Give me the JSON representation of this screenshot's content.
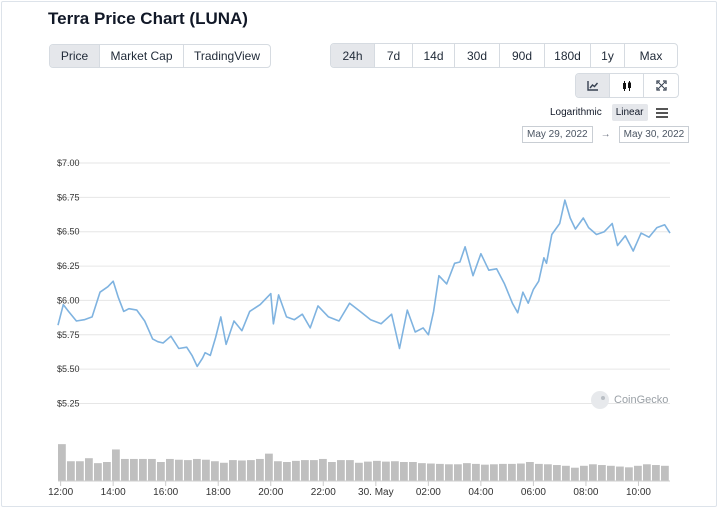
{
  "title": "Terra Price Chart (LUNA)",
  "view_tabs": [
    {
      "label": "Price",
      "active": true
    },
    {
      "label": "Market Cap",
      "active": false
    },
    {
      "label": "TradingView",
      "active": false
    }
  ],
  "range_tabs": [
    {
      "label": "24h",
      "active": true
    },
    {
      "label": "7d",
      "active": false
    },
    {
      "label": "14d",
      "active": false
    },
    {
      "label": "30d",
      "active": false
    },
    {
      "label": "90d",
      "active": false
    },
    {
      "label": "180d",
      "active": false
    },
    {
      "label": "1y",
      "active": false
    },
    {
      "label": "Max",
      "active": false
    }
  ],
  "tools": [
    {
      "icon": "line-chart-icon",
      "active": true
    },
    {
      "icon": "candlestick-icon",
      "active": false
    },
    {
      "icon": "fullscreen-icon",
      "active": false
    }
  ],
  "scale": {
    "logarithmic": "Logarithmic",
    "linear": "Linear",
    "active": "linear"
  },
  "date_range": {
    "from": "May 29, 2022",
    "to": "May 30, 2022",
    "arrow": "→"
  },
  "watermark": "CoinGecko",
  "colors": {
    "line": "#7fb3e0",
    "volume": "#bfbfbf",
    "grid": "#e6e6e6",
    "axis_text": "#333333"
  },
  "chart_data": {
    "type": "line",
    "title": "",
    "xlabel": "",
    "ylabel": "",
    "y_ticks": [
      "$5.25",
      "$5.50",
      "$5.75",
      "$6.00",
      "$6.25",
      "$6.50",
      "$6.75",
      "$7.00"
    ],
    "y_tick_values": [
      5.25,
      5.5,
      5.75,
      6.0,
      6.25,
      6.5,
      6.75,
      7.0
    ],
    "ylim": [
      5.13,
      7.0
    ],
    "x_ticks": [
      "12:00",
      "14:00",
      "16:00",
      "18:00",
      "20:00",
      "22:00",
      "30. May",
      "02:00",
      "04:00",
      "06:00",
      "08:00",
      "10:00"
    ],
    "x_tick_hours": [
      12,
      14,
      16,
      18,
      20,
      22,
      24,
      26,
      28,
      30,
      32,
      34
    ],
    "xlim_hours": [
      11.9,
      35.2
    ],
    "grid": true,
    "series": [
      {
        "x": [
          11.9,
          12.1,
          12.3,
          12.6,
          12.9,
          13.2,
          13.5,
          13.8,
          14.0,
          14.2,
          14.4,
          14.6,
          14.9,
          15.2,
          15.5,
          15.7,
          15.9,
          16.2,
          16.5,
          16.8,
          17.0,
          17.2,
          17.4,
          17.5,
          17.7,
          17.9,
          18.1,
          18.3,
          18.6,
          18.9,
          19.2,
          19.6,
          20.0,
          20.1,
          20.3,
          20.6,
          20.9,
          21.2,
          21.5,
          21.8,
          22.2,
          22.6,
          23.0,
          23.4,
          23.8,
          24.2,
          24.6,
          24.9,
          25.2,
          25.5,
          25.8,
          26.0,
          26.2,
          26.4,
          26.7,
          27.0,
          27.2,
          27.4,
          27.7,
          28.0,
          28.3,
          28.6,
          28.9,
          29.2,
          29.4,
          29.6,
          29.8,
          30.0,
          30.2,
          30.4,
          30.5,
          30.7,
          31.0,
          31.2,
          31.4,
          31.6,
          31.9,
          32.1,
          32.4,
          32.7,
          33.0,
          33.2,
          33.5,
          33.8,
          34.1,
          34.4,
          34.7,
          35.0,
          35.2
        ],
        "y": [
          5.82,
          5.97,
          5.92,
          5.85,
          5.86,
          5.88,
          6.06,
          6.1,
          6.14,
          6.02,
          5.92,
          5.94,
          5.93,
          5.85,
          5.72,
          5.7,
          5.69,
          5.74,
          5.65,
          5.66,
          5.6,
          5.52,
          5.58,
          5.62,
          5.6,
          5.73,
          5.88,
          5.68,
          5.85,
          5.78,
          5.92,
          5.97,
          6.05,
          5.83,
          6.04,
          5.88,
          5.86,
          5.9,
          5.8,
          5.96,
          5.88,
          5.85,
          5.98,
          5.92,
          5.86,
          5.83,
          5.9,
          5.65,
          5.93,
          5.77,
          5.8,
          5.75,
          5.92,
          6.18,
          6.12,
          6.27,
          6.28,
          6.39,
          6.18,
          6.34,
          6.22,
          6.23,
          6.12,
          5.98,
          5.91,
          6.06,
          5.98,
          6.08,
          6.14,
          6.31,
          6.27,
          6.48,
          6.56,
          6.73,
          6.6,
          6.52,
          6.6,
          6.53,
          6.48,
          6.5,
          6.56,
          6.4,
          6.47,
          6.36,
          6.49,
          6.46,
          6.53,
          6.55,
          6.49
        ]
      }
    ],
    "volume": {
      "x_start_hours": 11.9,
      "x_end_hours": 35.2,
      "relative_heights": [
        0.97,
        0.52,
        0.52,
        0.6,
        0.47,
        0.5,
        0.83,
        0.58,
        0.58,
        0.58,
        0.58,
        0.5,
        0.58,
        0.56,
        0.55,
        0.58,
        0.56,
        0.52,
        0.48,
        0.55,
        0.54,
        0.55,
        0.58,
        0.72,
        0.52,
        0.5,
        0.53,
        0.55,
        0.55,
        0.58,
        0.5,
        0.55,
        0.55,
        0.48,
        0.51,
        0.53,
        0.51,
        0.52,
        0.5,
        0.5,
        0.47,
        0.46,
        0.45,
        0.44,
        0.44,
        0.47,
        0.45,
        0.43,
        0.44,
        0.45,
        0.45,
        0.46,
        0.5,
        0.45,
        0.44,
        0.42,
        0.4,
        0.35,
        0.4,
        0.44,
        0.42,
        0.4,
        0.38,
        0.36,
        0.4,
        0.44,
        0.42,
        0.4
      ]
    }
  }
}
